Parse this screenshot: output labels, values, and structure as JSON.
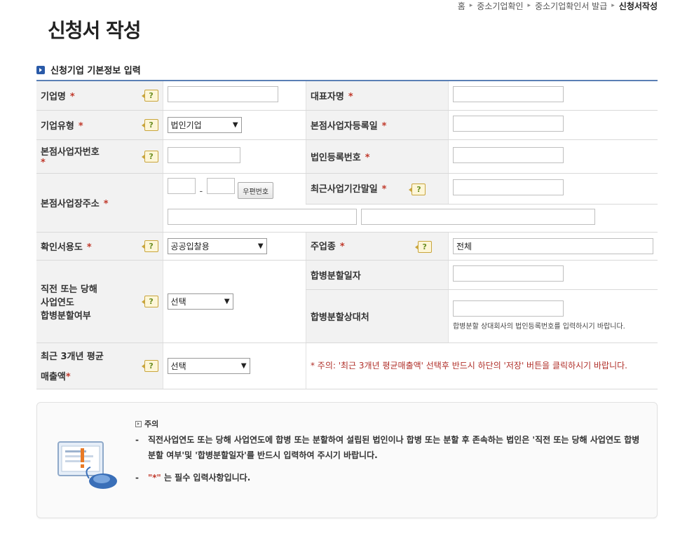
{
  "breadcrumb": {
    "items": [
      "홈",
      "중소기업확인",
      "중소기업확인서 발급",
      "신청서작성"
    ]
  },
  "page_title": "신청서 작성",
  "section_title": "신청기업 기본정보 입력",
  "help_glyph": "?",
  "required_mark": "*",
  "form": {
    "company_name": {
      "label": "기업명"
    },
    "ceo_name": {
      "label": "대표자명"
    },
    "company_type": {
      "label": "기업유형",
      "value": "법인기업"
    },
    "hq_reg_date": {
      "label": "본점사업자등록일"
    },
    "hq_biz_number": {
      "label": "본점사업자번호"
    },
    "corp_reg_number": {
      "label": "법인등록번호"
    },
    "hq_address": {
      "label": "본점사업장주소",
      "zip_button": "우편번호",
      "zip_separator": "-"
    },
    "last_period_end": {
      "label": "최근사업기간말일"
    },
    "certificate_use": {
      "label": "확인서용도",
      "value": "공공입찰용"
    },
    "main_industry": {
      "label": "주업종",
      "value": "전체"
    },
    "merger_split": {
      "label_lines": [
        "직전 또는 당해",
        "사업연도",
        "합병분할여부"
      ],
      "value": "선택"
    },
    "merger_date": {
      "label": "합병분할일자"
    },
    "merger_partner": {
      "label": "합병분할상대처",
      "hint": "합병분할 상대회사의 법인등록번호를 입력하시기 바랍니다."
    },
    "avg_sales": {
      "label_line1": "최근 3개년 평균",
      "label_line2": "매출액",
      "value": "선택"
    },
    "avg_sales_warning": "* 주의: '최근 3개년 평균매출액' 선택후 반드시 하단의 '저장' 버튼을 클릭하시기 바랍니다."
  },
  "notice": {
    "heading": "주의",
    "item1": "직전사업연도 또는 당해 사업연도에 합병 또는 분할하여 설립된 법인이나 합병 또는 분할 후 존속하는 법인은 '직전 또는 당해 사업연도 합병분할 여부'및 '합병분할일자'를 반드시 입력하여 주시기 바랍니다.",
    "item2_mark": "\"*\"",
    "item2_text": " 는 필수 입력사항입니다.",
    "bullet": "-"
  },
  "colors": {
    "accent": "#2a5aa8",
    "required": "#c0392b",
    "header_border": "#5a7fb5"
  },
  "icons": [
    "help-question-icon",
    "notice-monitor-mouse-icon",
    "section-bullet-icon"
  ]
}
